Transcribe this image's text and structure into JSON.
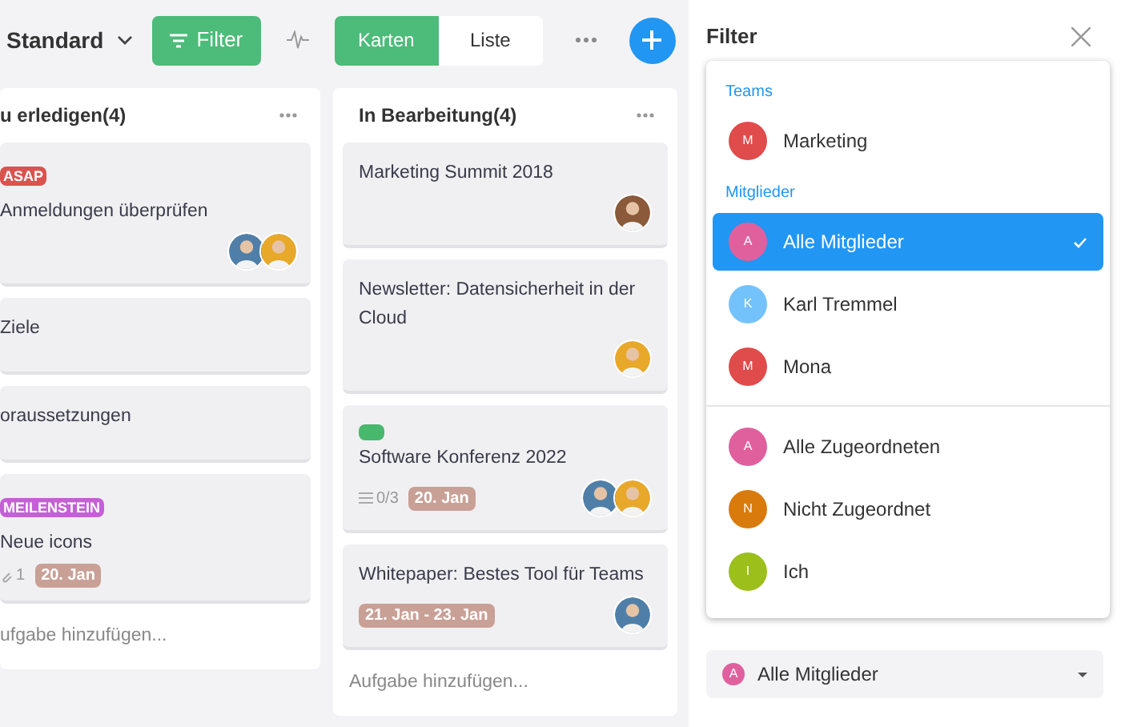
{
  "toolbar": {
    "view": "Standard",
    "filter_button": "Filter",
    "view_tabs": [
      {
        "label": "Karten",
        "selected": true
      },
      {
        "label": "Liste",
        "selected": false
      }
    ]
  },
  "columns": [
    {
      "title": "u erledigen(4)",
      "cards": [
        {
          "tag": {
            "label": "ASAP",
            "color": "#d9534f"
          },
          "title": "Anmeldungen überprüfen",
          "assignees": [
            {
              "color": "#4f7fa8"
            },
            {
              "color": "#e8a82a"
            }
          ]
        },
        {
          "title": "Ziele"
        },
        {
          "title": "oraussetzungen"
        },
        {
          "tag": {
            "label": "MEILENSTEIN",
            "color": "#c45fd6"
          },
          "title": "Neue icons",
          "attachments": "1",
          "date": "20. Jan"
        }
      ],
      "add_task": "ufgabe hinzufügen..."
    },
    {
      "title": "In Bearbeitung(4)",
      "cards": [
        {
          "title": "Marketing Summit 2018",
          "assignees": [
            {
              "color": "#8a5a3a"
            }
          ]
        },
        {
          "title": "Newsletter: Datensicherheit in der Cloud",
          "assignees": [
            {
              "color": "#e8a82a"
            }
          ]
        },
        {
          "label": {
            "color": "#48b86d"
          },
          "title": "Software Konferenz 2022",
          "checklist": "0/3",
          "date": "20. Jan",
          "assignees": [
            {
              "color": "#4f7fa8"
            },
            {
              "color": "#e8a82a"
            }
          ]
        },
        {
          "title": "Whitepaper: Bestes Tool für Teams",
          "date": "21. Jan - 23. Jan",
          "assignees": [
            {
              "color": "#4f7fa8"
            }
          ]
        }
      ],
      "add_task": "Aufgabe hinzufügen..."
    }
  ],
  "filter_panel": {
    "title": "Filter",
    "dropdown": {
      "groups": [
        {
          "heading": "Teams",
          "items": [
            {
              "initial": "M",
              "label": "Marketing",
              "color": "#e04b4b",
              "selected": false
            }
          ]
        },
        {
          "heading": "Mitglieder",
          "items": [
            {
              "initial": "A",
              "label": "Alle Mitglieder",
              "color": "#e0609e",
              "selected": true
            },
            {
              "initial": "K",
              "label": "Karl Tremmel",
              "color": "#74c2fb",
              "selected": false
            },
            {
              "initial": "M",
              "label": "Mona",
              "color": "#e04b4b",
              "selected": false
            }
          ]
        },
        {
          "items": [
            {
              "initial": "A",
              "label": "Alle Zugeordneten",
              "color": "#e0609e",
              "selected": false
            },
            {
              "initial": "N",
              "label": "Nicht Zugeordnet",
              "color": "#d97a0c",
              "selected": false
            },
            {
              "initial": "I",
              "label": "Ich",
              "color": "#9cbf1c",
              "selected": false
            }
          ]
        }
      ]
    },
    "select": {
      "initial": "A",
      "label": "Alle Mitglieder",
      "color": "#e0609e"
    }
  }
}
